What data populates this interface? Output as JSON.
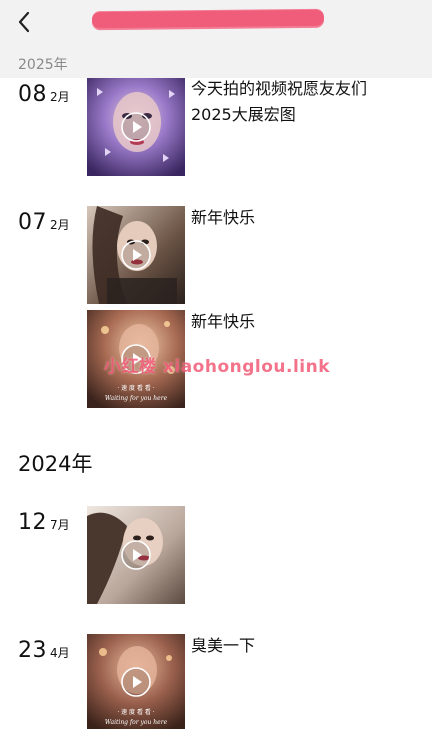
{
  "header": {
    "back_icon": "chevron-left-icon"
  },
  "sticky_year": "2025年",
  "watermark": "小红楼 xiaohonglou.link",
  "groups": [
    {
      "day": "08",
      "month": "2月",
      "posts": [
        {
          "caption": "今天拍的视频祝愿友友们\n2025大展宏图",
          "thumb_colors": [
            "#7a5fb6",
            "#caa9e6",
            "#3d2a66"
          ]
        }
      ]
    },
    {
      "day": "07",
      "month": "2月",
      "posts": [
        {
          "caption": "新年快乐",
          "thumb_colors": [
            "#6b5445",
            "#c7b2a3",
            "#2f2622"
          ]
        },
        {
          "caption": "新年快乐",
          "thumb_colors": [
            "#8a5a4a",
            "#d9a88f",
            "#3d2620"
          ],
          "overlay": [
            "· 速 度 看 看 ·",
            "Waiting for you here"
          ]
        }
      ]
    }
  ],
  "year_2024": "2024年",
  "groups_2024": [
    {
      "day": "12",
      "month": "7月",
      "posts": [
        {
          "caption": "",
          "thumb_colors": [
            "#a59388",
            "#e6ddd6",
            "#5b4a40"
          ]
        }
      ]
    },
    {
      "day": "23",
      "month": "4月",
      "posts": [
        {
          "caption": "臭美一下",
          "thumb_colors": [
            "#8b5747",
            "#d5a387",
            "#3a2219"
          ],
          "overlay": [
            "· 速 度 看 看 ·",
            "Waiting for you here"
          ]
        }
      ]
    }
  ],
  "icons": {
    "play": "play-icon"
  }
}
